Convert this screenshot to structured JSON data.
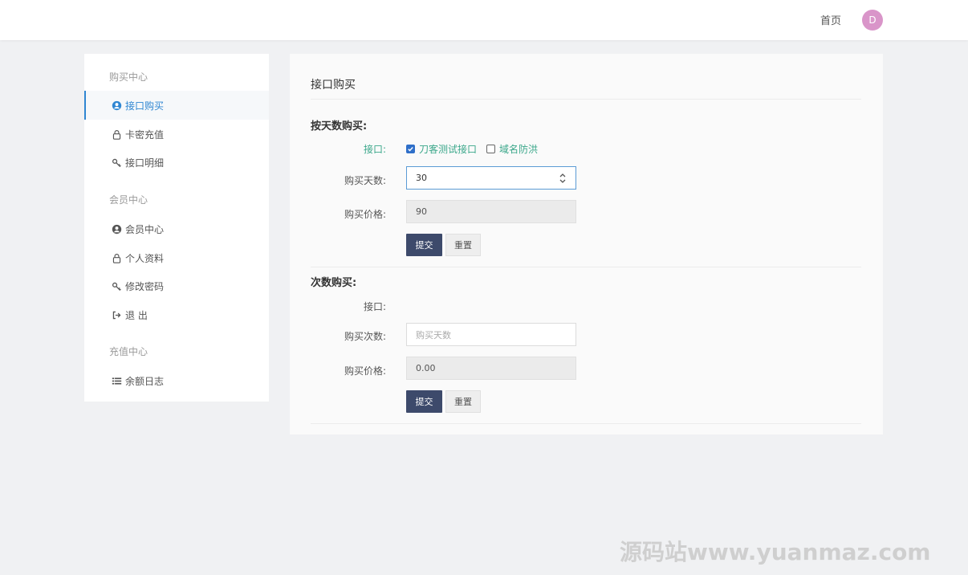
{
  "header": {
    "home_label": "首页",
    "avatar_initial": "D",
    "avatar_color": "#d995c9"
  },
  "sidebar": {
    "groups": [
      {
        "title": "购买中心",
        "items": [
          {
            "label": "接口购买",
            "icon": "user-circle-icon",
            "active": true
          },
          {
            "label": "卡密充值",
            "icon": "lock-icon",
            "active": false
          },
          {
            "label": "接口明细",
            "icon": "key-icon",
            "active": false
          }
        ]
      },
      {
        "title": "会员中心",
        "items": [
          {
            "label": "会员中心",
            "icon": "user-circle-icon",
            "active": false
          },
          {
            "label": "个人资料",
            "icon": "lock-icon",
            "active": false
          },
          {
            "label": "修改密码",
            "icon": "key-icon",
            "active": false
          },
          {
            "label": "退 出",
            "icon": "sign-out-icon",
            "active": false
          }
        ]
      },
      {
        "title": "充值中心",
        "items": [
          {
            "label": "余额日志",
            "icon": "list-icon",
            "active": false
          }
        ]
      }
    ],
    "active_color": "#2f86d2"
  },
  "main": {
    "title": "接口购买",
    "by_days": {
      "section_title": "按天数购买:",
      "api_label": "接口:",
      "options": [
        {
          "label": "刀客测试接口",
          "checked": true
        },
        {
          "label": "域名防洪",
          "checked": false
        }
      ],
      "days_label": "购买天数:",
      "days_value": "30",
      "price_label": "购买价格:",
      "price_value": "90",
      "submit_label": "提交",
      "reset_label": "重置"
    },
    "by_count": {
      "section_title": "次数购买:",
      "api_label": "接口:",
      "count_label": "购买次数:",
      "count_placeholder": "购买天数",
      "price_label": "购买价格:",
      "price_value": "0.00",
      "submit_label": "提交",
      "reset_label": "重置"
    },
    "primary_button_color": "#3d4a6b"
  },
  "watermark": "源码站www.yuanmaz.com"
}
